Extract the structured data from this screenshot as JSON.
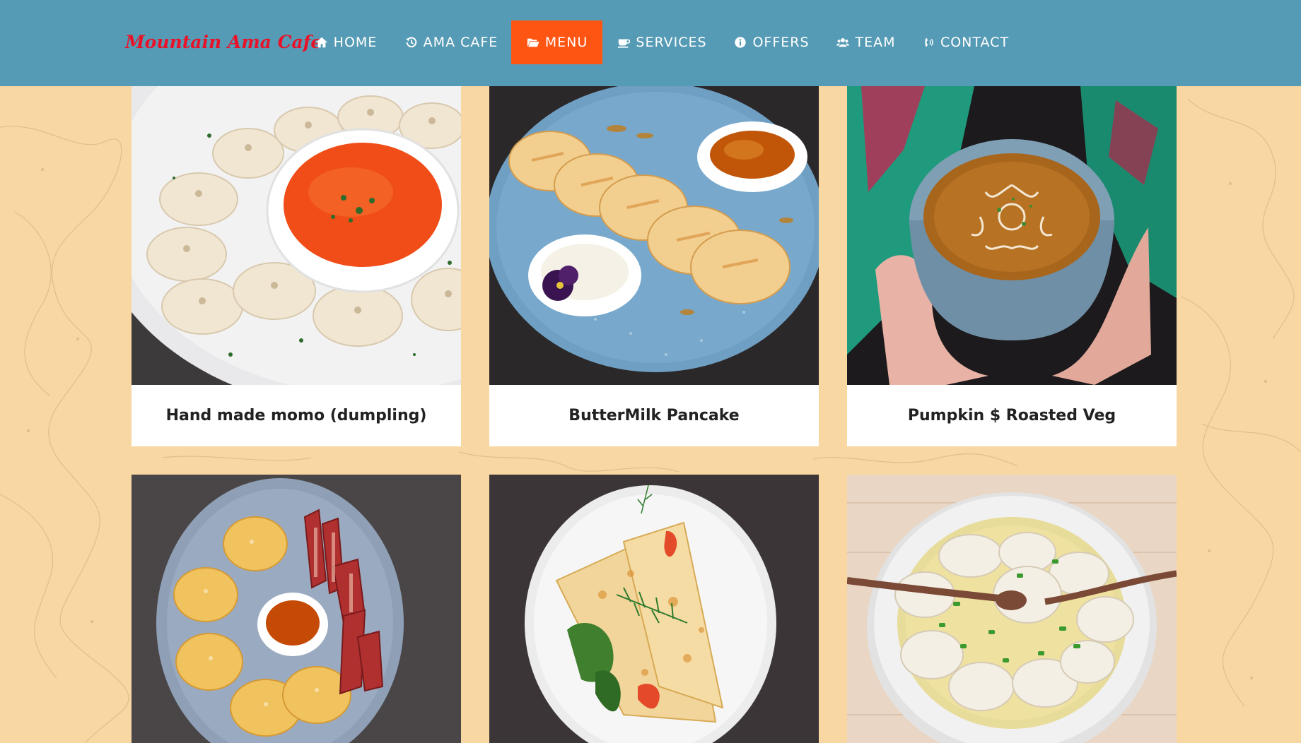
{
  "brand": {
    "name": "Mountain Ama Cafe"
  },
  "nav": {
    "items": [
      {
        "label": "HOME",
        "icon": "home-icon"
      },
      {
        "label": "AMA CAFE",
        "icon": "history-icon"
      },
      {
        "label": "MENU",
        "icon": "folder-open-icon",
        "active": true
      },
      {
        "label": "SERVICES",
        "icon": "coffee-cup-icon"
      },
      {
        "label": "OFFERS",
        "icon": "info-circle-icon"
      },
      {
        "label": "TEAM",
        "icon": "users-icon"
      },
      {
        "label": "CONTACT",
        "icon": "phone-volume-icon"
      }
    ]
  },
  "menu": {
    "items": [
      {
        "title": "Hand made momo (dumpling)",
        "image": "momo-plate-image"
      },
      {
        "title": "ButterMilk Pancake",
        "image": "pancake-plate-image"
      },
      {
        "title": "Pumpkin $ Roasted Veg",
        "image": "pumpkin-soup-image"
      },
      {
        "title": "",
        "image": "pancake-bacon-plate-image"
      },
      {
        "title": "",
        "image": "crepe-plate-image"
      },
      {
        "title": "",
        "image": "dumpling-soup-image"
      }
    ]
  },
  "colors": {
    "navbar": "#569bb5",
    "active_nav": "#ff5513",
    "brand": "#e8132a",
    "page_background": "#f8d7a2"
  }
}
